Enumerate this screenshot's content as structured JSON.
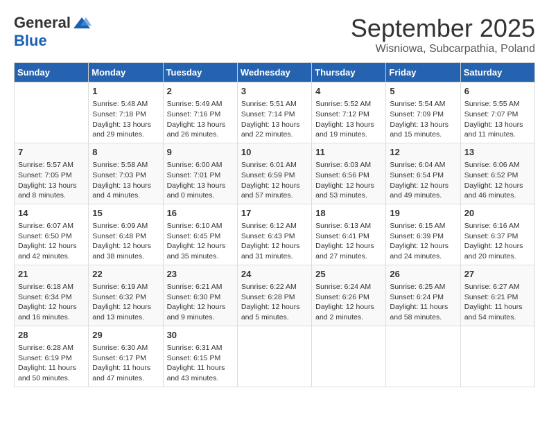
{
  "logo": {
    "general": "General",
    "blue": "Blue"
  },
  "header": {
    "month": "September 2025",
    "location": "Wisniowa, Subcarpathia, Poland"
  },
  "weekdays": [
    "Sunday",
    "Monday",
    "Tuesday",
    "Wednesday",
    "Thursday",
    "Friday",
    "Saturday"
  ],
  "weeks": [
    [
      {
        "day": "",
        "info": ""
      },
      {
        "day": "1",
        "info": "Sunrise: 5:48 AM\nSunset: 7:18 PM\nDaylight: 13 hours and 29 minutes."
      },
      {
        "day": "2",
        "info": "Sunrise: 5:49 AM\nSunset: 7:16 PM\nDaylight: 13 hours and 26 minutes."
      },
      {
        "day": "3",
        "info": "Sunrise: 5:51 AM\nSunset: 7:14 PM\nDaylight: 13 hours and 22 minutes."
      },
      {
        "day": "4",
        "info": "Sunrise: 5:52 AM\nSunset: 7:12 PM\nDaylight: 13 hours and 19 minutes."
      },
      {
        "day": "5",
        "info": "Sunrise: 5:54 AM\nSunset: 7:09 PM\nDaylight: 13 hours and 15 minutes."
      },
      {
        "day": "6",
        "info": "Sunrise: 5:55 AM\nSunset: 7:07 PM\nDaylight: 13 hours and 11 minutes."
      }
    ],
    [
      {
        "day": "7",
        "info": "Sunrise: 5:57 AM\nSunset: 7:05 PM\nDaylight: 13 hours and 8 minutes."
      },
      {
        "day": "8",
        "info": "Sunrise: 5:58 AM\nSunset: 7:03 PM\nDaylight: 13 hours and 4 minutes."
      },
      {
        "day": "9",
        "info": "Sunrise: 6:00 AM\nSunset: 7:01 PM\nDaylight: 13 hours and 0 minutes."
      },
      {
        "day": "10",
        "info": "Sunrise: 6:01 AM\nSunset: 6:59 PM\nDaylight: 12 hours and 57 minutes."
      },
      {
        "day": "11",
        "info": "Sunrise: 6:03 AM\nSunset: 6:56 PM\nDaylight: 12 hours and 53 minutes."
      },
      {
        "day": "12",
        "info": "Sunrise: 6:04 AM\nSunset: 6:54 PM\nDaylight: 12 hours and 49 minutes."
      },
      {
        "day": "13",
        "info": "Sunrise: 6:06 AM\nSunset: 6:52 PM\nDaylight: 12 hours and 46 minutes."
      }
    ],
    [
      {
        "day": "14",
        "info": "Sunrise: 6:07 AM\nSunset: 6:50 PM\nDaylight: 12 hours and 42 minutes."
      },
      {
        "day": "15",
        "info": "Sunrise: 6:09 AM\nSunset: 6:48 PM\nDaylight: 12 hours and 38 minutes."
      },
      {
        "day": "16",
        "info": "Sunrise: 6:10 AM\nSunset: 6:45 PM\nDaylight: 12 hours and 35 minutes."
      },
      {
        "day": "17",
        "info": "Sunrise: 6:12 AM\nSunset: 6:43 PM\nDaylight: 12 hours and 31 minutes."
      },
      {
        "day": "18",
        "info": "Sunrise: 6:13 AM\nSunset: 6:41 PM\nDaylight: 12 hours and 27 minutes."
      },
      {
        "day": "19",
        "info": "Sunrise: 6:15 AM\nSunset: 6:39 PM\nDaylight: 12 hours and 24 minutes."
      },
      {
        "day": "20",
        "info": "Sunrise: 6:16 AM\nSunset: 6:37 PM\nDaylight: 12 hours and 20 minutes."
      }
    ],
    [
      {
        "day": "21",
        "info": "Sunrise: 6:18 AM\nSunset: 6:34 PM\nDaylight: 12 hours and 16 minutes."
      },
      {
        "day": "22",
        "info": "Sunrise: 6:19 AM\nSunset: 6:32 PM\nDaylight: 12 hours and 13 minutes."
      },
      {
        "day": "23",
        "info": "Sunrise: 6:21 AM\nSunset: 6:30 PM\nDaylight: 12 hours and 9 minutes."
      },
      {
        "day": "24",
        "info": "Sunrise: 6:22 AM\nSunset: 6:28 PM\nDaylight: 12 hours and 5 minutes."
      },
      {
        "day": "25",
        "info": "Sunrise: 6:24 AM\nSunset: 6:26 PM\nDaylight: 12 hours and 2 minutes."
      },
      {
        "day": "26",
        "info": "Sunrise: 6:25 AM\nSunset: 6:24 PM\nDaylight: 11 hours and 58 minutes."
      },
      {
        "day": "27",
        "info": "Sunrise: 6:27 AM\nSunset: 6:21 PM\nDaylight: 11 hours and 54 minutes."
      }
    ],
    [
      {
        "day": "28",
        "info": "Sunrise: 6:28 AM\nSunset: 6:19 PM\nDaylight: 11 hours and 50 minutes."
      },
      {
        "day": "29",
        "info": "Sunrise: 6:30 AM\nSunset: 6:17 PM\nDaylight: 11 hours and 47 minutes."
      },
      {
        "day": "30",
        "info": "Sunrise: 6:31 AM\nSunset: 6:15 PM\nDaylight: 11 hours and 43 minutes."
      },
      {
        "day": "",
        "info": ""
      },
      {
        "day": "",
        "info": ""
      },
      {
        "day": "",
        "info": ""
      },
      {
        "day": "",
        "info": ""
      }
    ]
  ]
}
